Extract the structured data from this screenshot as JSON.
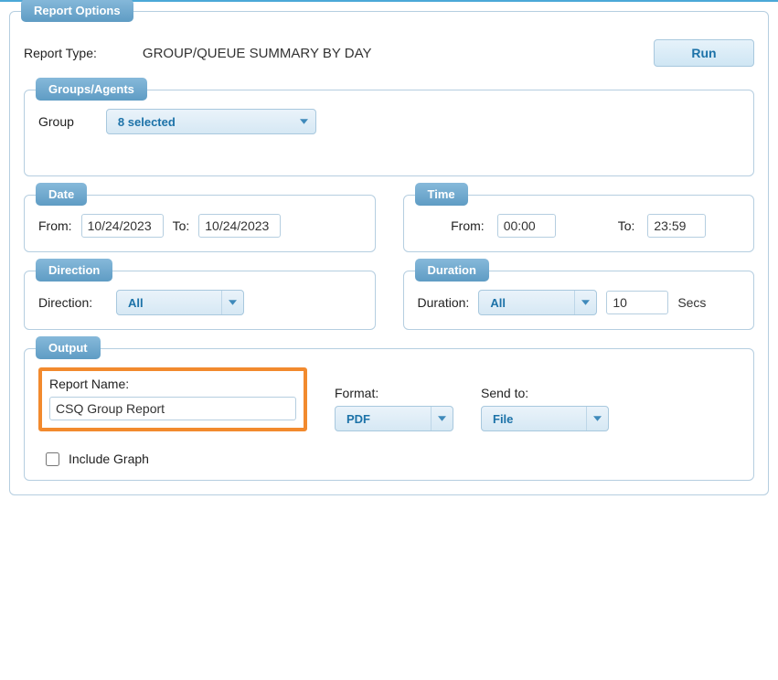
{
  "legend": {
    "report_options": "Report Options",
    "groups_agents": "Groups/Agents",
    "date": "Date",
    "time": "Time",
    "direction": "Direction",
    "duration": "Duration",
    "output": "Output"
  },
  "labels": {
    "report_type": "Report Type:",
    "group": "Group",
    "from": "From:",
    "to": "To:",
    "direction": "Direction:",
    "duration": "Duration:",
    "secs": "Secs",
    "report_name": "Report Name:",
    "format": "Format:",
    "send_to": "Send to:",
    "include_graph": "Include Graph"
  },
  "values": {
    "report_type": "GROUP/QUEUE SUMMARY BY DAY",
    "run_button": "Run",
    "group_selected": "8 selected",
    "date_from": "10/24/2023",
    "date_to": "10/24/2023",
    "time_from": "00:00",
    "time_to": "23:59",
    "direction": "All",
    "duration_type": "All",
    "duration_value": "10",
    "report_name": "CSQ Group Report",
    "format": "PDF",
    "send_to": "File",
    "include_graph_checked": false
  }
}
